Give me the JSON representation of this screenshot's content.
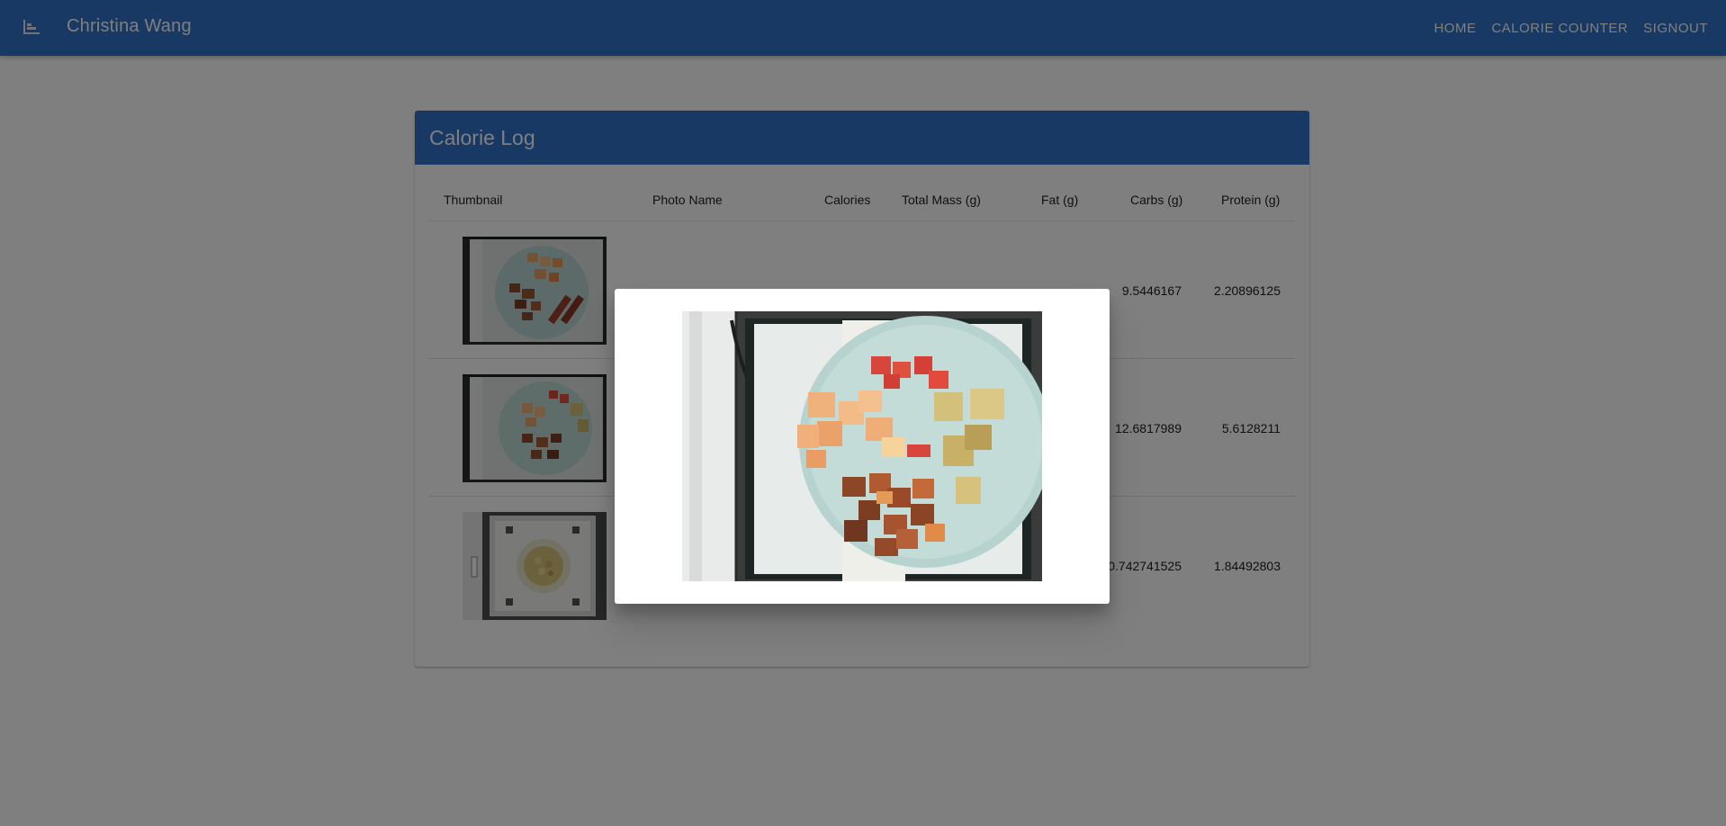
{
  "appbar": {
    "user_name": "Christina Wang",
    "menu_icon": "hamburger-icon",
    "nav": [
      "HOME",
      "CALORIE COUNTER",
      "SIGNOUT"
    ]
  },
  "card": {
    "title": "Calorie Log",
    "headers": {
      "thumbnail": "Thumbnail",
      "photo_name": "Photo Name",
      "calories": "Calories",
      "total_mass": "Total Mass (g)",
      "fat": "Fat (g)",
      "carbs": "Carbs (g)",
      "protein": "Protein (g)"
    },
    "rows": [
      {
        "carbs": "9.5446167",
        "protein": "2.20896125"
      },
      {
        "carbs": "12.6817989",
        "protein": "5.6128211"
      },
      {
        "carbs": "0.742741525",
        "protein": "1.84492803"
      }
    ]
  },
  "colors": {
    "primary": "#2f72c9",
    "overlay": "rgba(0,0,0,0.5)"
  }
}
